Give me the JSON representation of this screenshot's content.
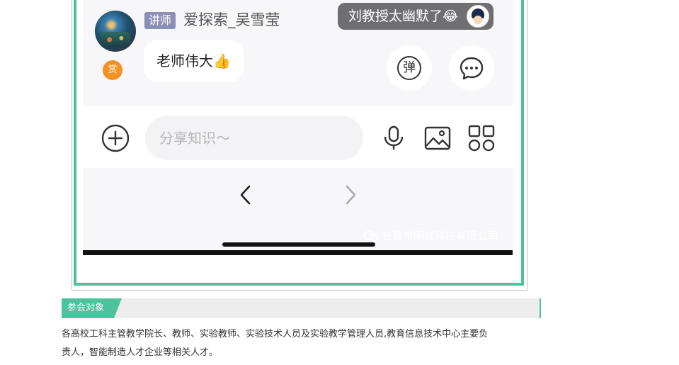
{
  "comment": {
    "role_badge": "讲师",
    "username": "爱探索_吴雪莹",
    "reward_label": "赏",
    "message": "老师伟大👍"
  },
  "danmu": {
    "text": "刘教授太幽默了😂"
  },
  "buttons": {
    "danmaku_glyph": "弹"
  },
  "input": {
    "placeholder": "分享知识～"
  },
  "icons": {
    "add": "plus-circle-icon",
    "voice": "microphone-icon",
    "image": "image-icon",
    "apps": "grid-icon",
    "back": "chevron-left-icon",
    "forward": "chevron-right-icon",
    "wechat": "wechat-icon",
    "comment": "comment-bubble-icon"
  },
  "watermark": "长春市明威科技有限公司",
  "section": {
    "tag": "参会对象",
    "body_line1": "各高校工科主管教学院长、教师、实验教师、实验技术人员及实验教学管理人员,教育信息技术中心主要负",
    "body_line2": "责人，智能制造人才企业等相关人才。"
  },
  "colors": {
    "accent_green": "#4cc39c",
    "badge_purple": "#8b8fb5",
    "reward_orange": "#f39223",
    "danmu_bg": "#6f6e73"
  }
}
